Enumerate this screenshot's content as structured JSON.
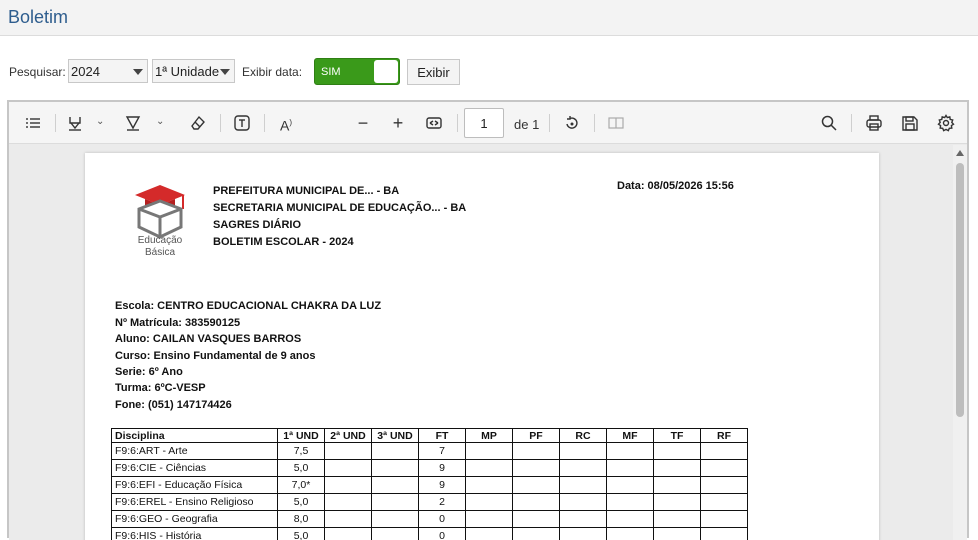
{
  "page": {
    "title": "Boletim"
  },
  "filters": {
    "search_label": "Pesquisar:",
    "year": "2024",
    "unit": "1ª Unidade",
    "show_date_label": "Exibir data:",
    "toggle_label": "SIM",
    "show_button": "Exibir"
  },
  "viewer": {
    "page_number": "1",
    "page_of": "de 1"
  },
  "report": {
    "logo_text": [
      "Educação",
      "Básica"
    ],
    "header_lines": [
      "PREFEITURA MUNICIPAL DE... - BA",
      "SECRETARIA MUNICIPAL DE EDUCAÇÃO... - BA",
      "SAGRES DIÁRIO",
      "BOLETIM ESCOLAR - 2024"
    ],
    "date": "Data:  08/05/2026 15:56",
    "info_lines": [
      "Escola: CENTRO EDUCACIONAL CHAKRA DA LUZ",
      "Nº Matrícula: 383590125",
      "Aluno: CAILAN VASQUES BARROS",
      "Curso: Ensino Fundamental de 9 anos",
      "Serie:  6º Ano",
      "Turma:  6ºC-VESP",
      "Fone: (051) 147174426"
    ],
    "table": {
      "columns": [
        "Disciplina",
        "1ª UND",
        "2ª UND",
        "3ª UND",
        "FT",
        "MP",
        "PF",
        "RC",
        "MF",
        "TF",
        "RF"
      ],
      "rows": [
        [
          "F9:6:ART - Arte",
          "7,5",
          "",
          "",
          "7",
          "",
          "",
          "",
          "",
          "",
          ""
        ],
        [
          "F9:6:CIE - Ciências",
          "5,0",
          "",
          "",
          "9",
          "",
          "",
          "",
          "",
          "",
          ""
        ],
        [
          "F9:6:EFI - Educação Física",
          "7,0*",
          "",
          "",
          "9",
          "",
          "",
          "",
          "",
          "",
          ""
        ],
        [
          "F9:6:EREL - Ensino Religioso",
          "5,0",
          "",
          "",
          "2",
          "",
          "",
          "",
          "",
          "",
          ""
        ],
        [
          "F9:6:GEO - Geografia",
          "8,0",
          "",
          "",
          "0",
          "",
          "",
          "",
          "",
          "",
          ""
        ],
        [
          "F9:6:HIS - História",
          "5,0",
          "",
          "",
          "0",
          "",
          "",
          "",
          "",
          "",
          ""
        ]
      ]
    }
  }
}
